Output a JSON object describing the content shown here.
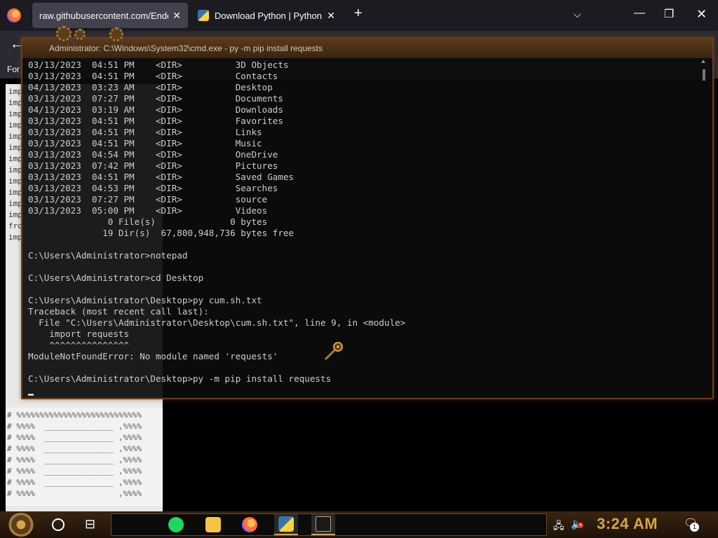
{
  "browser": {
    "tabs": [
      {
        "label": "raw.githubusercontent.com/Ender",
        "active": true
      },
      {
        "label": "Download Python | Python.org",
        "active": false
      }
    ],
    "new_tab": "+",
    "tab_list": "⌵",
    "window_controls": {
      "minimize": "—",
      "maximize": "❐",
      "close": "✕"
    },
    "back": "←",
    "bookmarks_label": "For"
  },
  "page_lines": [
    "import",
    "imp",
    "imp",
    "imp",
    "imp",
    "imp",
    "imp",
    "imp",
    "imp",
    "imp",
    "imp",
    "imp",
    "fro",
    "imp"
  ],
  "page_ascii": [
    "# %%%%%%%%%%%%%%%%%%%%%%%%%%%",
    "# %%%%  _______________ ,%%%%",
    "# %%%%  _______________ ,%%%%",
    "# %%%%  _______________ ,%%%%",
    "# %%%%  _______________ ,%%%%",
    "# %%%%  _______________ ,%%%%",
    "# %%%%  _______________ ,%%%%",
    "# %%%%                  ,%%%%"
  ],
  "cmd": {
    "title": "Administrator: C:\\Windows\\System32\\cmd.exe - py  -m pip install requests",
    "lines": [
      "03/13/2023  04:51 PM    <DIR>          3D Objects",
      "03/13/2023  04:51 PM    <DIR>          Contacts",
      "04/13/2023  03:23 AM    <DIR>          Desktop",
      "03/13/2023  07:27 PM    <DIR>          Documents",
      "04/13/2023  03:19 AM    <DIR>          Downloads",
      "03/13/2023  04:51 PM    <DIR>          Favorites",
      "03/13/2023  04:51 PM    <DIR>          Links",
      "03/13/2023  04:51 PM    <DIR>          Music",
      "03/13/2023  04:54 PM    <DIR>          OneDrive",
      "03/13/2023  07:42 PM    <DIR>          Pictures",
      "03/13/2023  04:51 PM    <DIR>          Saved Games",
      "03/13/2023  04:53 PM    <DIR>          Searches",
      "03/13/2023  07:27 PM    <DIR>          source",
      "03/13/2023  05:00 PM    <DIR>          Videos",
      "               0 File(s)              0 bytes",
      "              19 Dir(s)  67,800,948,736 bytes free",
      "",
      "C:\\Users\\Administrator>notepad",
      "",
      "C:\\Users\\Administrator>cd Desktop",
      "",
      "C:\\Users\\Administrator\\Desktop>py cum.sh.txt",
      "Traceback (most recent call last):",
      "  File \"C:\\Users\\Administrator\\Desktop\\cum.sh.txt\", line 9, in <module>",
      "    import requests",
      "    ^^^^^^^^^^^^^^^",
      "ModuleNotFoundError: No module named 'requests'",
      "",
      "C:\\Users\\Administrator\\Desktop>py -m pip install requests"
    ]
  },
  "taskbar": {
    "apps": [
      "spotify-icon",
      "file-explorer-icon",
      "firefox-icon",
      "python-installer-icon",
      "cmd-icon"
    ],
    "clock": "3:24 AM",
    "notifications": "1"
  },
  "colors": {
    "accent": "#d3a54a",
    "window_frame": "#6b3e1a",
    "console_text": "#cccccc"
  }
}
